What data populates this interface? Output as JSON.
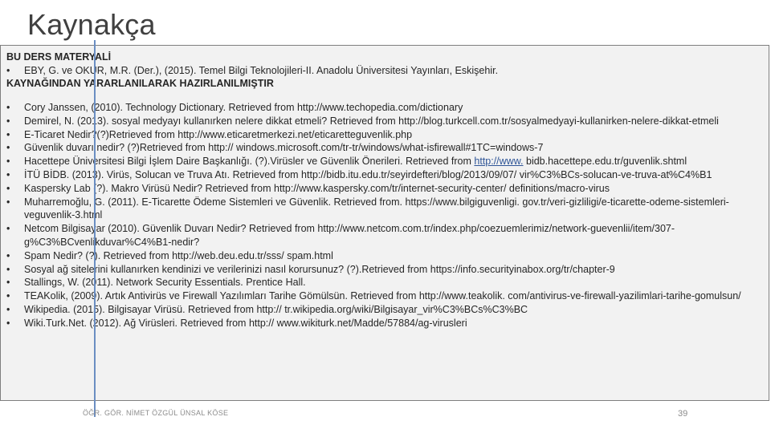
{
  "slide": {
    "title": "Kaynakça",
    "intro": {
      "heading": "BU DERS MATERYALİ",
      "bullet_text": "EBY, G. ve OKUR, M.R. (Der.), (2015). Temel Bilgi Teknolojileri-II. Anadolu Üniversitesi Yayınları, Eskişehir.",
      "subheading": "KAYNAĞINDAN YARARLANILARAK HAZIRLANILMIŞTIR"
    },
    "bullet_char": "•",
    "refs": [
      {
        "text": "Cory Janssen, (2010). Technology Dictionary. Retrieved from http://www.techopedia.com/dictionary"
      },
      {
        "text": "Demirel, N. (2013). sosyal medyayı kullanırken nelere dikkat etmeli? Retrieved from http://blog.turkcell.com.tr/sosyalmedyayi-kullanirken-nelere-dikkat-etmeli"
      },
      {
        "text": "E-Ticaret Nedir?(?)Retrieved from http://www.eticaretmerkezi.net/eticaretteguvenlik.php"
      },
      {
        "text": "Güvenlik duvarı nedir? (?)Retrieved from http:// windows.microsoft.com/tr-tr/windows/what-isfirewall#1TC=windows-7"
      },
      {
        "text": "Hacettepe Üniversitesi Bilgi İşlem Daire Başkanlığı. (?).Virüsler ve Güvenlik Önerileri. Retrieved from ",
        "link": "http://www.",
        "after": " bidb.hacettepe.edu.tr/guvenlik.shtml"
      },
      {
        "text": "İTÜ BİDB. (2013). Virüs, Solucan ve Truva Atı. Retrieved from http://bidb.itu.edu.tr/seyirdefteri/blog/2013/09/07/ vir%C3%BCs-solucan-ve-truva-at%C4%B1"
      },
      {
        "text": "Kaspersky Lab (?). Makro Virüsü Nedir? Retrieved from http://www.kaspersky.com/tr/internet-security-center/ definitions/macro-virus"
      },
      {
        "text": "Muharremoğlu, G. (2011). E-Ticarette Ödeme Sistemleri ve Güvenlik. Retrieved from. https://www.bilgiguvenligi. gov.tr/veri-gizliligi/e-ticarette-odeme-sistemleri-veguvenlik-3.html"
      },
      {
        "text": "Netcom Bilgisayar (2010). Güvenlik Duvarı Nedir? Retrieved from http://www.netcom.com.tr/index.php/coezuemlerimiz/network-guevenlii/item/307-g%C3%BCvenlikduvar%C4%B1-nedir?"
      },
      {
        "text": "Spam Nedir? (?). Retrieved from http://web.deu.edu.tr/sss/ spam.html"
      },
      {
        "text": "Sosyal ağ sitelerini kullanırken kendinizi ve verilerinizi nasıl korursunuz? (?).Retrieved from https://info.securityinabox.org/tr/chapter-9"
      },
      {
        "text": "Stallings, W. (2011). Network Security Essentials. Prentice Hall."
      },
      {
        "text": "TEAKolik, (2009). Artık Antivirüs ve Firewall Yazılımları Tarihe Gömülsün. Retrieved from http://www.teakolik. com/antivirus-ve-firewall-yazilimlari-tarihe-gomulsun/"
      },
      {
        "text": "Wikipedia. (2015). Bilgisayar Virüsü. Retrieved from http:// tr.wikipedia.org/wiki/Bilgisayar_vir%C3%BCs%C3%BC"
      },
      {
        "text": "Wiki.Turk.Net. (2012). Ağ Virüsleri. Retrieved from http:// www.wikiturk.net/Madde/57884/ag-virusleri"
      }
    ],
    "footer": "ÖĞR. GÖR. NİMET ÖZGÜL ÜNSAL KÖSE",
    "page_number": "39"
  }
}
